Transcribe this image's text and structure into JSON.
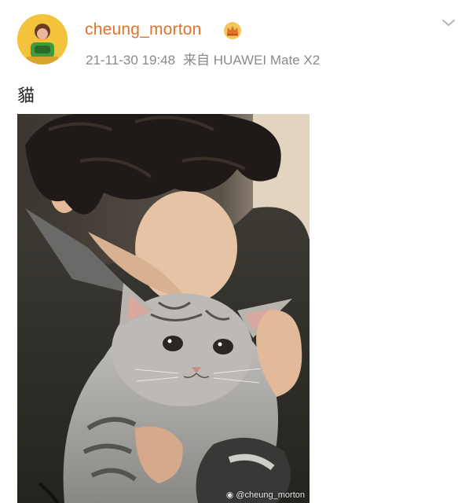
{
  "post": {
    "username": "cheung_morton",
    "timestamp": "21-11-30 19:48",
    "device": "来自 HUAWEI Mate X2",
    "text": "貓",
    "watermark": "@cheung_morton"
  },
  "icons": {
    "avatar": "avatar-image",
    "crown": "crown-badge-icon",
    "menu": "chevron-down-icon",
    "watermark_logo": "weibo-logo-icon"
  },
  "colors": {
    "username": "#e0722b",
    "meta": "#8a8a8a",
    "text": "#222222"
  }
}
